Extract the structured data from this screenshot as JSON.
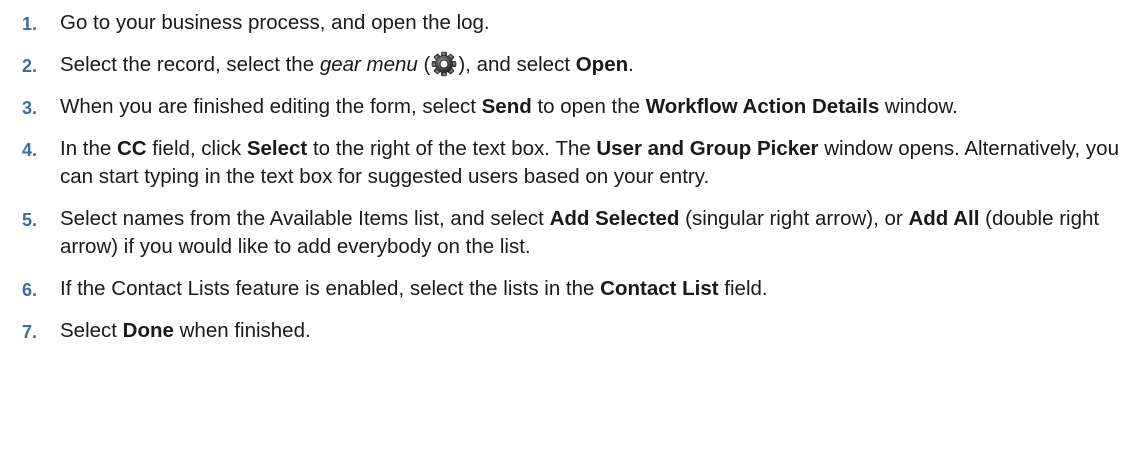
{
  "colors": {
    "step_number": "#3a6ea5",
    "text": "#1a1a1a"
  },
  "steps": [
    {
      "number": "1.",
      "parts": [
        {
          "t": "Go to your business process, and open the log."
        }
      ]
    },
    {
      "number": "2.",
      "parts": [
        {
          "t": "Select the record, select the "
        },
        {
          "t": "gear menu",
          "style": "italic"
        },
        {
          "t": " ("
        },
        {
          "icon": "gear-icon"
        },
        {
          "t": "), and select "
        },
        {
          "t": "Open",
          "style": "bold"
        },
        {
          "t": "."
        }
      ]
    },
    {
      "number": "3.",
      "parts": [
        {
          "t": "When you are finished editing the form, select "
        },
        {
          "t": "Send",
          "style": "bold"
        },
        {
          "t": " to open the "
        },
        {
          "t": "Workflow Action Details",
          "style": "bold"
        },
        {
          "t": " window."
        }
      ]
    },
    {
      "number": "4.",
      "parts": [
        {
          "t": "In the "
        },
        {
          "t": "CC",
          "style": "bold"
        },
        {
          "t": " field, click "
        },
        {
          "t": "Select",
          "style": "bold"
        },
        {
          "t": " to the right of the text box. The "
        },
        {
          "t": "User and Group Picker",
          "style": "bold"
        },
        {
          "t": " window opens. Alternatively, you can start typing in the text box for suggested users based on your entry."
        }
      ]
    },
    {
      "number": "5.",
      "parts": [
        {
          "t": "Select names from the Available Items list, and select "
        },
        {
          "t": "Add Selected",
          "style": "bold"
        },
        {
          "t": " (singular right arrow), or "
        },
        {
          "t": "Add All",
          "style": "bold"
        },
        {
          "t": " (double right arrow) if you would like to add everybody on the list."
        }
      ]
    },
    {
      "number": "6.",
      "parts": [
        {
          "t": "If the Contact Lists feature is enabled, select the lists in the "
        },
        {
          "t": "Contact List",
          "style": "bold"
        },
        {
          "t": " field."
        }
      ]
    },
    {
      "number": "7.",
      "parts": [
        {
          "t": "Select "
        },
        {
          "t": "Done",
          "style": "bold"
        },
        {
          "t": " when finished."
        }
      ]
    }
  ]
}
